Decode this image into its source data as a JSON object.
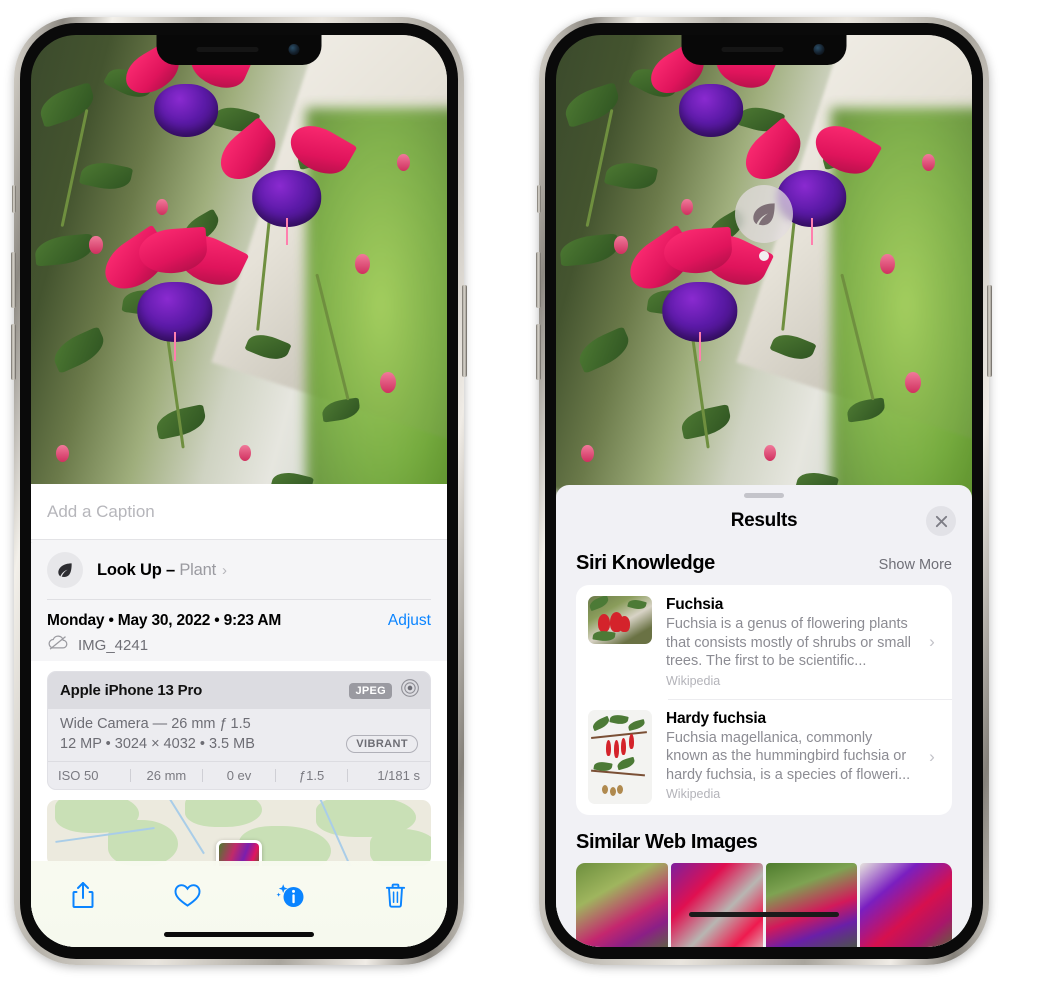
{
  "left_phone": {
    "caption_placeholder": "Add a Caption",
    "lookup": {
      "label": "Look Up",
      "dash": " – ",
      "subject": "Plant",
      "chevron": "›",
      "icon": "leaf-icon"
    },
    "metadata": {
      "date": "Monday • May 30, 2022 • 9:23 AM",
      "adjust_label": "Adjust",
      "filename": "IMG_4241",
      "cloud_icon": "icloud-slash-icon"
    },
    "exif": {
      "device": "Apple iPhone 13 Pro",
      "format_tag": "JPEG",
      "aperture_icon": "lens-icon",
      "lens": "Wide Camera — 26 mm ƒ 1.5",
      "size": "12 MP • 3024 × 4032 • 3.5 MB",
      "style_tag": "VIBRANT",
      "stats": [
        "ISO 50",
        "26 mm",
        "0 ev",
        "ƒ1.5",
        "1/181 s"
      ]
    },
    "toolbar": [
      {
        "name": "share-button",
        "icon": "share-icon"
      },
      {
        "name": "favorite-button",
        "icon": "heart-icon"
      },
      {
        "name": "info-button",
        "icon": "info-sparkle-icon"
      },
      {
        "name": "delete-button",
        "icon": "trash-icon"
      }
    ],
    "accent_color": "#0a84ff"
  },
  "right_phone": {
    "visual_lookup_pin": {
      "icon": "leaf-icon"
    },
    "sheet": {
      "title": "Results",
      "close_icon": "close-icon",
      "grabber": "drag-handle"
    },
    "siri_knowledge": {
      "heading": "Siri Knowledge",
      "action": "Show More",
      "items": [
        {
          "title": "Fuchsia",
          "description": "Fuchsia is a genus of flowering plants that consists mostly of shrubs or small trees. The first to be scientific...",
          "source": "Wikipedia",
          "chevron": "›"
        },
        {
          "title": "Hardy fuchsia",
          "description": "Fuchsia magellanica, commonly known as the hummingbird fuchsia or hardy fuchsia, is a species of floweri...",
          "source": "Wikipedia",
          "chevron": "›"
        }
      ]
    },
    "similar_web_images": {
      "heading": "Similar Web Images",
      "count": 4
    }
  }
}
